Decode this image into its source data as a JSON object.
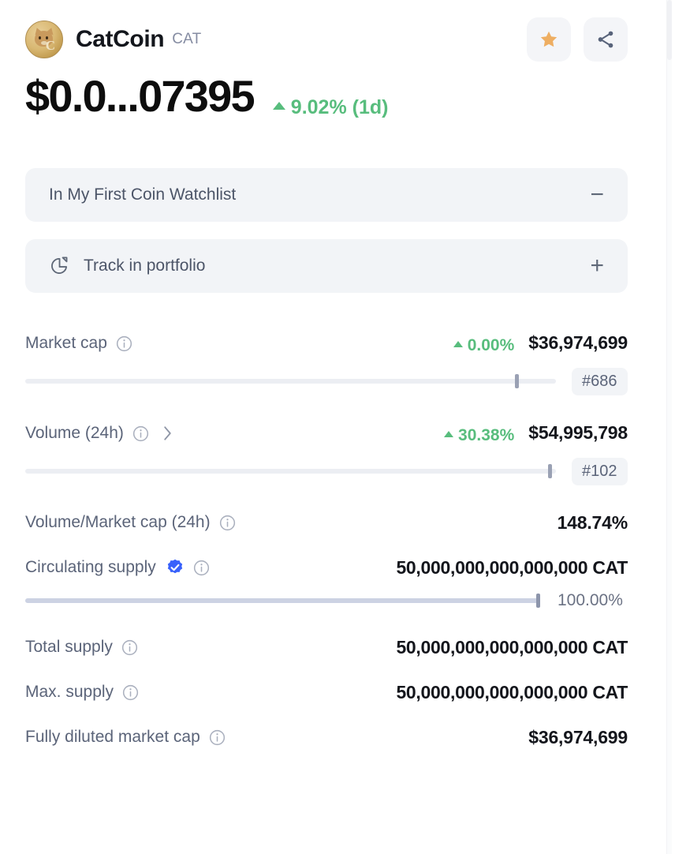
{
  "header": {
    "coin_name": "CatCoin",
    "ticker": "CAT",
    "logo_icon": "catcoin-logo",
    "favorite_icon": "star-icon",
    "share_icon": "share-icon"
  },
  "price": {
    "value": "$0.0...07395",
    "change_percent": "9.02% (1d)",
    "change_direction": "up",
    "change_color": "#58bd7d"
  },
  "actions": {
    "watchlist_label": "In My First Coin Watchlist",
    "watchlist_sign": "−",
    "portfolio_label": "Track in portfolio",
    "portfolio_sign": "+",
    "portfolio_icon": "pie-chart-icon"
  },
  "stats": {
    "market_cap": {
      "label": "Market cap",
      "change": "0.00%",
      "value": "$36,974,699",
      "rank": "#686",
      "bar_fill_percent": 92
    },
    "volume_24h": {
      "label": "Volume (24h)",
      "change": "30.38%",
      "value": "$54,995,798",
      "rank": "#102",
      "bar_fill_percent": 99
    },
    "volume_market_cap": {
      "label": "Volume/Market cap (24h)",
      "value": "148.74%"
    },
    "circulating_supply": {
      "label": "Circulating supply",
      "value": "50,000,000,000,000,000 CAT",
      "percent": "100.00%",
      "verified": true,
      "bar_fill_percent": 100
    },
    "total_supply": {
      "label": "Total supply",
      "value": "50,000,000,000,000,000 CAT"
    },
    "max_supply": {
      "label": "Max. supply",
      "value": "50,000,000,000,000,000 CAT"
    },
    "fully_diluted_market_cap": {
      "label": "Fully diluted market cap",
      "value": "$36,974,699"
    }
  },
  "colors": {
    "positive": "#58bd7d",
    "pill_bg": "#f2f4f7",
    "text_muted": "#5b6479",
    "verified_blue": "#3861fb",
    "star_orange": "#eeae62"
  }
}
